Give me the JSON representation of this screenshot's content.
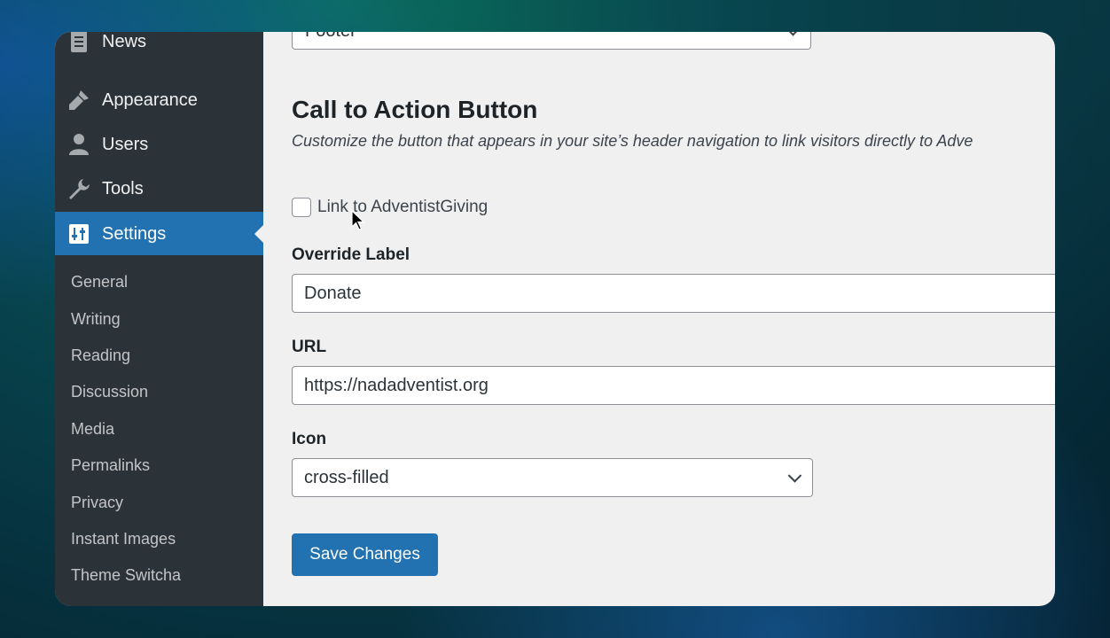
{
  "sidebar": {
    "menu": [
      {
        "label": "News",
        "icon": "news-icon"
      },
      {
        "label": "Appearance",
        "icon": "brush-icon"
      },
      {
        "label": "Users",
        "icon": "user-icon"
      },
      {
        "label": "Tools",
        "icon": "wrench-icon"
      },
      {
        "label": "Settings",
        "icon": "settings-icon",
        "active": true
      }
    ],
    "submenu": [
      "General",
      "Writing",
      "Reading",
      "Discussion",
      "Media",
      "Permalinks",
      "Privacy",
      "Instant Images",
      "Theme Switcha"
    ]
  },
  "content": {
    "top_select_value": "Footer",
    "section_title": "Call to Action Button",
    "section_desc": "Customize the button that appears in your site’s header navigation to link visitors directly to Adve",
    "checkbox_label": "Link to AdventistGiving",
    "checkbox_checked": false,
    "override_label": {
      "label": "Override Label",
      "value": "Donate"
    },
    "url": {
      "label": "URL",
      "value": "https://nadadventist.org"
    },
    "icon_select": {
      "label": "Icon",
      "value": "cross-filled"
    },
    "save_label": "Save Changes"
  },
  "colors": {
    "sidebar_bg": "#2c3338",
    "accent": "#2271b1",
    "content_bg": "#f0f0f1"
  }
}
